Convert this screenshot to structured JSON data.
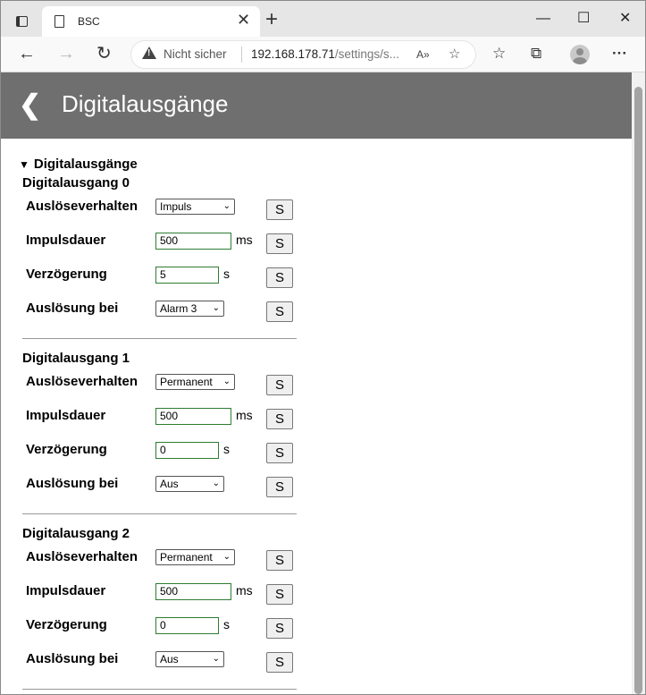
{
  "browser": {
    "tab_title": "BSC",
    "security_label": "Nicht sicher",
    "url_host": "192.168.178.71",
    "url_path": "/settings/s...",
    "icons": {
      "window": "window-menu-icon",
      "page": "page-icon",
      "close_tab": "✕",
      "new_tab": "+",
      "minimize": "—",
      "maximize": "☐",
      "close": "✕",
      "back": "←",
      "forward": "→",
      "reload": "↻",
      "read_aloud": "A»",
      "favorite_add": "☆",
      "favorites": "☆",
      "collections": "⧉",
      "menu": "···"
    }
  },
  "page": {
    "back_symbol": "❮",
    "title": "Digitalausgänge",
    "summary": "Digitalausgänge",
    "save_label": "S",
    "sections": [
      {
        "title": "Digitalausgang 0",
        "rows": {
          "behavior": {
            "label": "Auslöseverhalten",
            "value": "Impuls"
          },
          "duration": {
            "label": "Impulsdauer",
            "value": "500",
            "unit": "ms"
          },
          "delay": {
            "label": "Verzögerung",
            "value": "5",
            "unit": "s"
          },
          "trigger": {
            "label": "Auslösung bei",
            "value": "Alarm 3"
          }
        }
      },
      {
        "title": "Digitalausgang 1",
        "rows": {
          "behavior": {
            "label": "Auslöseverhalten",
            "value": "Permanent"
          },
          "duration": {
            "label": "Impulsdauer",
            "value": "500",
            "unit": "ms"
          },
          "delay": {
            "label": "Verzögerung",
            "value": "0",
            "unit": "s"
          },
          "trigger": {
            "label": "Auslösung bei",
            "value": "Aus"
          }
        }
      },
      {
        "title": "Digitalausgang 2",
        "rows": {
          "behavior": {
            "label": "Auslöseverhalten",
            "value": "Permanent"
          },
          "duration": {
            "label": "Impulsdauer",
            "value": "500",
            "unit": "ms"
          },
          "delay": {
            "label": "Verzögerung",
            "value": "0",
            "unit": "s"
          },
          "trigger": {
            "label": "Auslösung bei",
            "value": "Aus"
          }
        }
      }
    ]
  }
}
